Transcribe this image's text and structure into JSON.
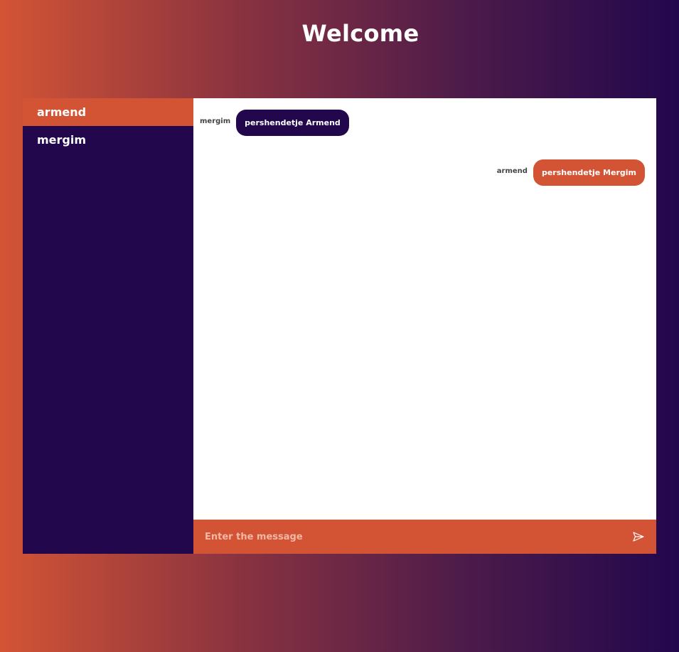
{
  "header": {
    "title": "Welcome"
  },
  "sidebar": {
    "contacts": [
      {
        "name": "armend",
        "active": true
      },
      {
        "name": "mergim",
        "active": false
      }
    ]
  },
  "chat": {
    "messages": [
      {
        "sender": "mergim",
        "text": "pershendetje Armend",
        "side": "left"
      },
      {
        "sender": "armend",
        "text": "pershendetje Mergim",
        "side": "right"
      }
    ]
  },
  "composer": {
    "placeholder": "Enter the message",
    "value": "",
    "send_icon": "send-icon"
  },
  "colors": {
    "accent": "#d35435",
    "dark": "#22074d",
    "background_start": "#d35435",
    "background_end": "#22074d"
  }
}
